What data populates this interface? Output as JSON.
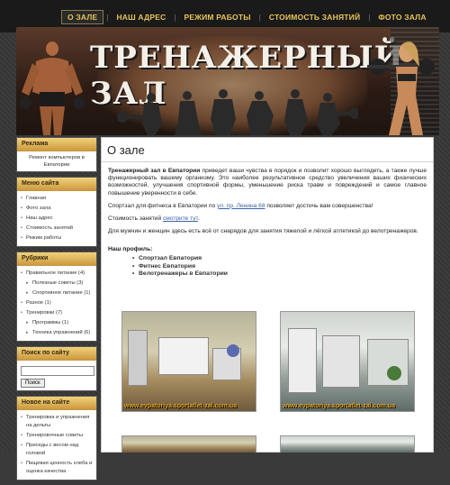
{
  "nav": {
    "items": [
      "О ЗАЛЕ",
      "НАШ АДРЕС",
      "РЕЖИМ РАБОТЫ",
      "СТОИМОСТЬ ЗАНЯТИЙ",
      "ФОТО ЗАЛА"
    ],
    "active_index": 0
  },
  "header": {
    "title": "ТРЕНАЖЕРНЫЙ ЗАЛ"
  },
  "sidebar": {
    "ads": {
      "title": "Реклама",
      "text": "Ремонт компьютеров в Евпатории"
    },
    "menu": {
      "title": "Меню сайта",
      "items": [
        "Главная",
        "Фото зала",
        "Наш адрес",
        "Стоимость занятий",
        "Режим работы"
      ]
    },
    "categories": {
      "title": "Рубрики",
      "items": [
        {
          "label": "Правильное питание (4)",
          "sub": false
        },
        {
          "label": "Полезные советы (3)",
          "sub": true
        },
        {
          "label": "Спортивное питание (1)",
          "sub": true
        },
        {
          "label": "Разное (1)",
          "sub": false
        },
        {
          "label": "Тренировки (7)",
          "sub": false
        },
        {
          "label": "Программы (1)",
          "sub": true
        },
        {
          "label": "Техника упражнений (6)",
          "sub": true
        }
      ]
    },
    "search": {
      "title": "Поиск по сайту",
      "button": "Поиск"
    },
    "news": {
      "title": "Новое на сайте",
      "items": [
        "Тренировка и упражнения на дельты",
        "Тренировочные советы",
        "Приседы с весом над головой",
        "Пищевая ценность хлеба и оценка качества"
      ]
    }
  },
  "main": {
    "title": "О зале",
    "p1_bold": "Тренажерный зал в Евпатории",
    "p1_rest": " приведет ваши чувства в порядок и позволит хорошо выглядеть, а также лучше функционировать вашему организму. Это наиболее результативное средство увеличения ваших физических возможностей, улучшения спортивной формы, уменьшение риска травм и повреждений и самое главное повышение уверенности в себе.",
    "p2_pre": "Спортзал для фитнеса в Евпатории по ",
    "p2_link": "ул. пр. Ленина 68",
    "p2_post": " позволяет достичь вам совершенства!",
    "p3_pre": "Стоимость занятий ",
    "p3_link": "смотрите тут",
    "p3_post": ".",
    "p4": "Для мужчин и женщин здесь есть всё от снарядов для занятия тяжелой и лёгкой атлетикой до велотренажеров.",
    "profile_title": "Наш профиль:",
    "profile": [
      "Спортзал Евпатория",
      "Фитнес Евпатория",
      "Велотренажеры в Евпатории"
    ],
    "photo_captions": [
      "www.evpatoriya.sportatlet-zal.com.ua",
      "www.evpatoriya.sportatlet-zal.com.ua"
    ]
  }
}
